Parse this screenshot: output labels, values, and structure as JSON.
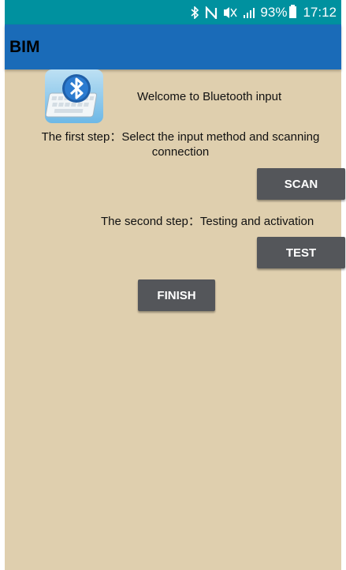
{
  "status_bar": {
    "icons": [
      "bluetooth-icon",
      "nfc-icon",
      "mute-icon",
      "signal-icon",
      "battery-icon"
    ],
    "battery": "93%",
    "time": "17:12"
  },
  "app_bar": {
    "title": "BIM"
  },
  "main": {
    "welcome": "Welcome to Bluetooth input",
    "step1": "The first step：Select the input method and scanning connection",
    "step2": "The second step：Testing and activation"
  },
  "buttons": {
    "scan": "SCAN",
    "test": "TEST",
    "finish": "FINISH"
  },
  "colors": {
    "status_bar": "#00919f",
    "app_bar": "#1a6bb8",
    "background": "#dfcfae",
    "button": "#54565a"
  }
}
